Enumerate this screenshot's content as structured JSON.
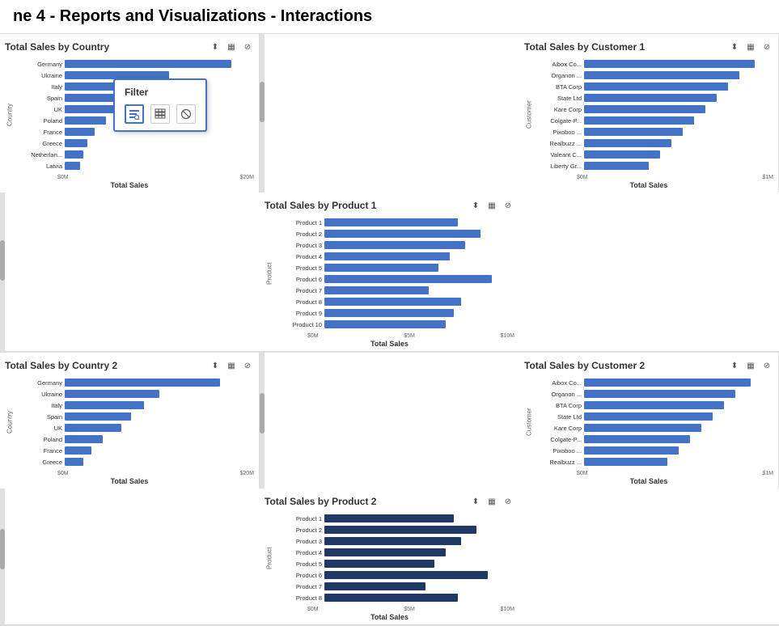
{
  "title": "ne 4 - Reports and Visualizations - Interactions",
  "filter_popup": {
    "title": "Filter",
    "icons": [
      "bar_filter",
      "table_view",
      "no_filter"
    ]
  },
  "row1": {
    "charts": [
      {
        "id": "country1",
        "title": "Total Sales by Country",
        "y_axis": "Country",
        "x_axis_title": "Total Sales",
        "x_ticks": [
          "$0M",
          "$20M"
        ],
        "bars": [
          {
            "label": "Germany",
            "pct": 88
          },
          {
            "label": "Ukraine",
            "pct": 55
          },
          {
            "label": "Italy",
            "pct": 45
          },
          {
            "label": "Spain",
            "pct": 38
          },
          {
            "label": "UK",
            "pct": 33
          },
          {
            "label": "Poland",
            "pct": 22
          },
          {
            "label": "France",
            "pct": 16
          },
          {
            "label": "Greece",
            "pct": 12
          },
          {
            "label": "Netherlan...",
            "pct": 10
          },
          {
            "label": "Latvia",
            "pct": 8
          }
        ],
        "color": "blue"
      },
      {
        "id": "customer1",
        "title": "Total Sales by Customer 1",
        "y_axis": "Customer",
        "x_axis_title": "Total Sales",
        "x_ticks": [
          "$0M",
          "$1M"
        ],
        "bars": [
          {
            "label": "Aibox Co...",
            "pct": 90
          },
          {
            "label": "Organon ...",
            "pct": 82
          },
          {
            "label": "BTA Corp",
            "pct": 76
          },
          {
            "label": "State Ltd",
            "pct": 70
          },
          {
            "label": "Kare Corp",
            "pct": 64
          },
          {
            "label": "Colgate-P...",
            "pct": 58
          },
          {
            "label": "Pixoboo ...",
            "pct": 52
          },
          {
            "label": "Realbuzz ...",
            "pct": 46
          },
          {
            "label": "Valeant C...",
            "pct": 40
          },
          {
            "label": "Liberty Gr...",
            "pct": 34
          }
        ],
        "color": "blue"
      },
      {
        "id": "product1",
        "title": "Total Sales by Product 1",
        "y_axis": "Product",
        "x_axis_title": "Total Sales",
        "x_ticks": [
          "$0M",
          "$5M",
          "$10M"
        ],
        "bars": [
          {
            "label": "Product 1",
            "pct": 70
          },
          {
            "label": "Product 2",
            "pct": 82
          },
          {
            "label": "Product 3",
            "pct": 74
          },
          {
            "label": "Product 4",
            "pct": 66
          },
          {
            "label": "Product 5",
            "pct": 60
          },
          {
            "label": "Product 6",
            "pct": 88
          },
          {
            "label": "Product 7",
            "pct": 55
          },
          {
            "label": "Product 8",
            "pct": 72
          },
          {
            "label": "Product 9",
            "pct": 68
          },
          {
            "label": "Product 10",
            "pct": 64
          }
        ],
        "color": "blue"
      }
    ]
  },
  "row2": {
    "charts": [
      {
        "id": "country2",
        "title": "Total Sales by Country 2",
        "y_axis": "Country",
        "x_axis_title": "Total Sales",
        "x_ticks": [
          "$0M",
          "$20M"
        ],
        "bars": [
          {
            "label": "Germany",
            "pct": 82
          },
          {
            "label": "Ukraine",
            "pct": 50
          },
          {
            "label": "Italy",
            "pct": 42
          },
          {
            "label": "Spain",
            "pct": 35
          },
          {
            "label": "UK",
            "pct": 30
          },
          {
            "label": "Poland",
            "pct": 20
          },
          {
            "label": "France",
            "pct": 14
          },
          {
            "label": "Greece",
            "pct": 10
          }
        ],
        "color": "blue"
      },
      {
        "id": "customer2",
        "title": "Total Sales by Customer 2",
        "y_axis": "Customer",
        "x_axis_title": "Total Sales",
        "x_ticks": [
          "$0M",
          "$1M"
        ],
        "bars": [
          {
            "label": "Aibox Co...",
            "pct": 88
          },
          {
            "label": "Organon ...",
            "pct": 80
          },
          {
            "label": "BTA Corp",
            "pct": 74
          },
          {
            "label": "State Ltd",
            "pct": 68
          },
          {
            "label": "Kare Corp",
            "pct": 62
          },
          {
            "label": "Colgate-P...",
            "pct": 56
          },
          {
            "label": "Pixoboo ...",
            "pct": 50
          },
          {
            "label": "Realbuzz ...",
            "pct": 44
          }
        ],
        "color": "blue"
      },
      {
        "id": "product2",
        "title": "Total Sales by Product 2",
        "y_axis": "Product",
        "x_axis_title": "Total Sales",
        "x_ticks": [
          "$0M",
          "$5M",
          "$10M"
        ],
        "bars": [
          {
            "label": "Product 1",
            "pct": 68
          },
          {
            "label": "Product 2",
            "pct": 80
          },
          {
            "label": "Product 3",
            "pct": 72
          },
          {
            "label": "Product 4",
            "pct": 64
          },
          {
            "label": "Product 5",
            "pct": 58
          },
          {
            "label": "Product 6",
            "pct": 86
          },
          {
            "label": "Product 7",
            "pct": 53
          },
          {
            "label": "Product 8",
            "pct": 70
          }
        ],
        "color": "darkblue"
      }
    ]
  }
}
